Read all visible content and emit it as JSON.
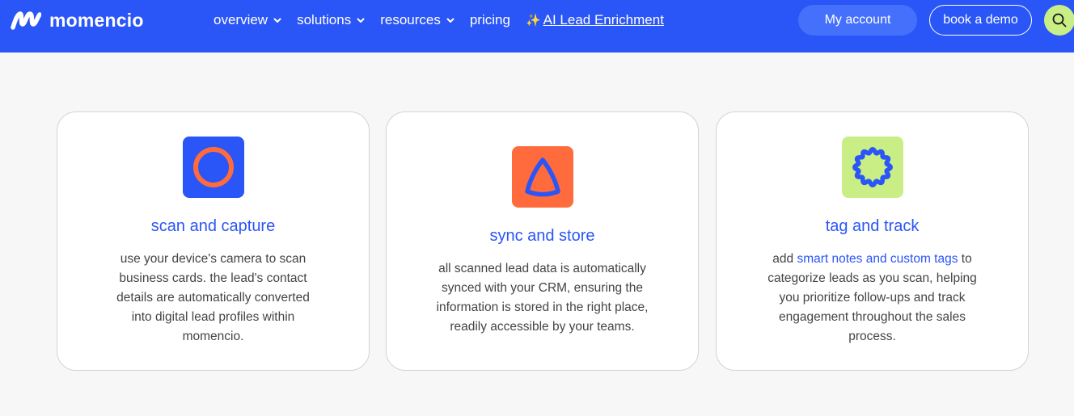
{
  "brand": {
    "name": "momencio"
  },
  "nav": {
    "items": [
      {
        "label": "overview",
        "dropdown": true
      },
      {
        "label": "solutions",
        "dropdown": true
      },
      {
        "label": "resources",
        "dropdown": true
      },
      {
        "label": "pricing",
        "dropdown": false
      }
    ],
    "ai_link": {
      "icon": "sparkles-icon",
      "label": "AI Lead Enrichment"
    }
  },
  "header_actions": {
    "account_label": "My account",
    "demo_label": "book a demo",
    "search_icon": "search-icon"
  },
  "colors": {
    "primary_blue": "#2a55f7",
    "accent_orange": "#ff6b3d",
    "accent_green": "#c9ee85",
    "page_bg": "#f7f7f7"
  },
  "features": [
    {
      "icon": "circle-icon",
      "title": "scan and capture",
      "desc_lines": [
        "use your device's camera to scan",
        "business cards. the lead's contact",
        "details are automatically converted",
        "into digital lead profiles within",
        "momencio."
      ]
    },
    {
      "icon": "rounded-triangle-icon",
      "title": "sync and store",
      "desc_lines": [
        "all scanned lead data is automatically",
        "synced with your CRM, ensuring the",
        "information is stored in the right place,",
        "readily accessible by your teams."
      ]
    },
    {
      "icon": "scalloped-circle-icon",
      "title": "tag and track",
      "desc_prefix": "add ",
      "desc_link": "smart notes and custom tags",
      "desc_suffix": " to",
      "desc_lines": [
        "categorize leads as you scan, helping",
        "you prioritize follow-ups and track",
        "engagement throughout the sales",
        "process."
      ]
    }
  ]
}
